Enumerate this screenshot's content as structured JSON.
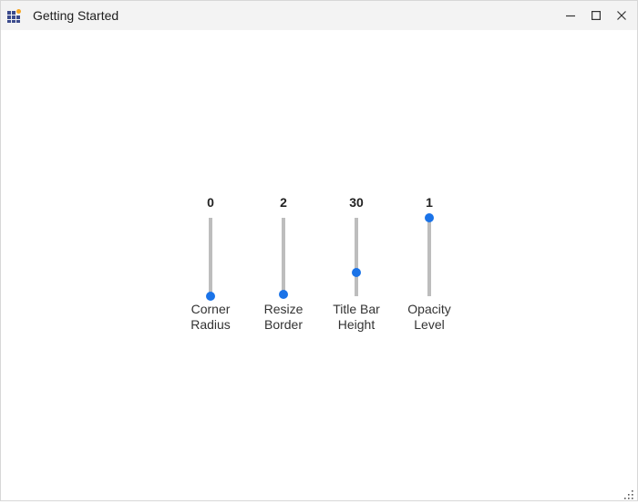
{
  "window": {
    "title": "Getting Started",
    "icons": {
      "app": "app-grid-icon",
      "minimize": "minimize-icon",
      "maximize": "maximize-icon",
      "close": "close-icon",
      "resize": "resize-grip-icon"
    }
  },
  "sliders": [
    {
      "value_text": "0",
      "label_line1": "Corner",
      "label_line2": "Radius",
      "level": 0.0
    },
    {
      "value_text": "2",
      "label_line1": "Resize",
      "label_line2": "Border",
      "level": 0.02
    },
    {
      "value_text": "30",
      "label_line1": "Title Bar",
      "label_line2": "Height",
      "level": 0.3
    },
    {
      "value_text": "1",
      "label_line1": "Opacity",
      "label_line2": "Level",
      "level": 1.0
    }
  ],
  "colors": {
    "accent": "#1a73e8",
    "track": "#bdbdbd",
    "titlebar": "#f3f3f3"
  }
}
